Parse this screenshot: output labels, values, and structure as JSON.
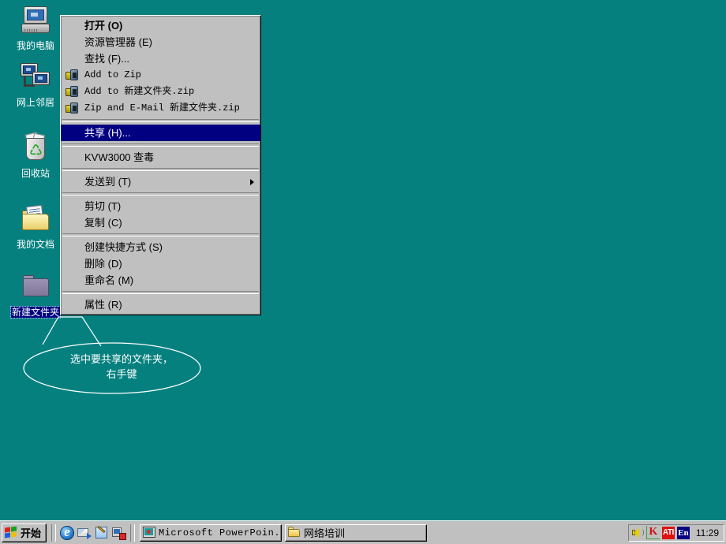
{
  "desktop": {
    "background_color": "#05807f",
    "icons": [
      {
        "label": "我的电脑",
        "name": "my-computer"
      },
      {
        "label": "网上邻居",
        "name": "network-neighborhood"
      },
      {
        "label": "回收站",
        "name": "recycle-bin"
      },
      {
        "label": "我的文档",
        "name": "my-documents"
      },
      {
        "label": "新建文件夹",
        "name": "new-folder",
        "selected": true
      }
    ]
  },
  "context_menu": {
    "highlight_color": "#000080",
    "background_color": "#c0c0c0",
    "items": [
      {
        "label": "打开 (O)",
        "bold": true,
        "type": "item"
      },
      {
        "label": "资源管理器 (E)",
        "type": "item"
      },
      {
        "label": "查找 (F)...",
        "type": "item"
      },
      {
        "label": "Add to Zip",
        "type": "item",
        "icon": "winzip-icon",
        "mono": true
      },
      {
        "label": "Add to 新建文件夹.zip",
        "type": "item",
        "icon": "winzip-icon",
        "mono": true
      },
      {
        "label": "Zip and E-Mail 新建文件夹.zip",
        "type": "item",
        "icon": "winzip-icon",
        "mono": true
      },
      {
        "type": "separator"
      },
      {
        "label": "共享 (H)...",
        "type": "item",
        "selected": true
      },
      {
        "type": "separator"
      },
      {
        "label": "KVW3000 查毒",
        "type": "item"
      },
      {
        "type": "separator"
      },
      {
        "label": "发送到 (T)",
        "type": "item",
        "submenu": true
      },
      {
        "type": "separator"
      },
      {
        "label": "剪切 (T)",
        "type": "item"
      },
      {
        "label": "复制 (C)",
        "type": "item"
      },
      {
        "type": "separator"
      },
      {
        "label": "创建快捷方式 (S)",
        "type": "item"
      },
      {
        "label": "删除 (D)",
        "type": "item"
      },
      {
        "label": "重命名 (M)",
        "type": "item"
      },
      {
        "type": "separator"
      },
      {
        "label": "属性 (R)",
        "type": "item"
      }
    ]
  },
  "callout": {
    "line1": "选中要共享的文件夹，",
    "line2": "右手键",
    "color": "#ffffff"
  },
  "taskbar": {
    "start_label": "开始",
    "quick_launch": [
      {
        "name": "internet-explorer-icon"
      },
      {
        "name": "outlook-express-icon"
      },
      {
        "name": "paint-icon"
      },
      {
        "name": "show-desktop-icon"
      }
    ],
    "tasks": [
      {
        "label": "Microsoft PowerPoin...",
        "icon": "powerpoint-icon",
        "active": false
      },
      {
        "label": "网络培训",
        "icon": "folder-icon",
        "active": false
      }
    ],
    "tray": [
      {
        "name": "volume-icon",
        "text": ""
      },
      {
        "name": "kv-antivirus-icon",
        "text": "K"
      },
      {
        "name": "ati-icon",
        "text": "ATI"
      },
      {
        "name": "ime-language-icon",
        "text": "En"
      }
    ],
    "clock": "11:29"
  }
}
